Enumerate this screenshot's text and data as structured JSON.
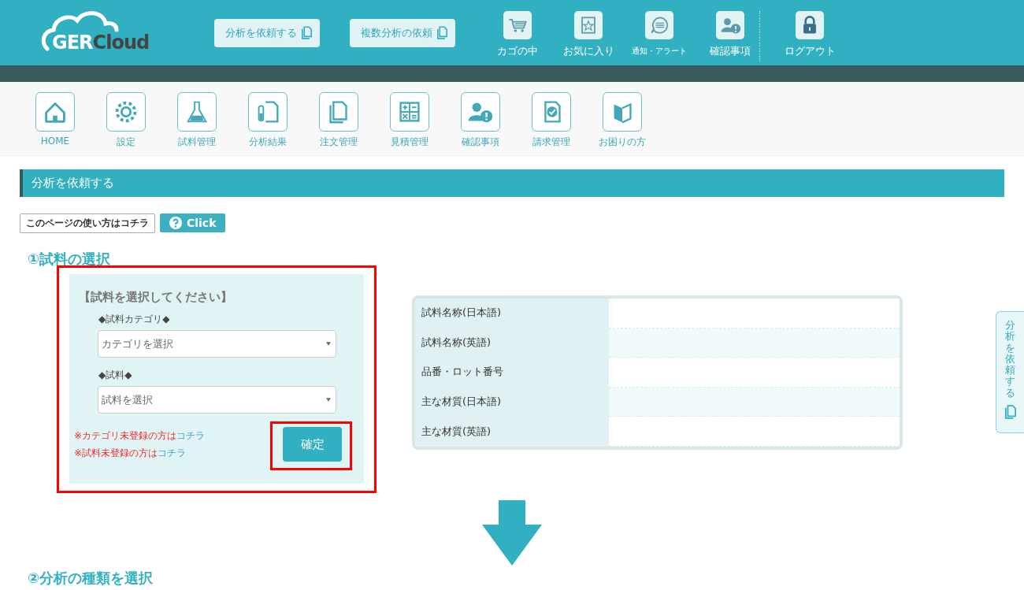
{
  "header": {
    "logo": {
      "text_1": "GER",
      "text_2": "Cloud"
    },
    "buttons": [
      "分析を依頼する",
      "複数分析の依頼"
    ],
    "icon_items": [
      {
        "label": "カゴの中",
        "kind": "normal"
      },
      {
        "label": "お気に入り",
        "kind": "normal"
      },
      {
        "label": "通知・アラート",
        "kind": "small"
      },
      {
        "label": "確認事項",
        "kind": "normal"
      }
    ],
    "logout": "ログアウト"
  },
  "nav": [
    "HOME",
    "設定",
    "試料管理",
    "分析結果",
    "注文管理",
    "見積管理",
    "確認事項",
    "請求管理",
    "お困りの方"
  ],
  "page_title": "分析を依頼する",
  "help": {
    "label": "このページの使い方はコチラ",
    "button": "Click"
  },
  "step_1": {
    "heading": "①試料の選択",
    "panel": {
      "highlighted": true,
      "title": "【試料を選択してください】",
      "fields": [
        {
          "label": "◆試料カテゴリ◆",
          "placeholder": "カテゴリを選択"
        },
        {
          "label": "◆試料◆",
          "placeholder": "試料を選択"
        }
      ],
      "notes": [
        {
          "text": "※カテゴリ未登録の方は",
          "link": "コチラ"
        },
        {
          "text": "※試料未登録の方は",
          "link": "コチラ"
        }
      ],
      "confirm": {
        "label": "確定",
        "highlighted": true
      }
    },
    "table": {
      "rows": [
        "試料名称(日本語)",
        "試料名称(英語)",
        "品番・ロット番号",
        "主な材質(日本語)",
        "主な材質(英語)"
      ]
    }
  },
  "step_2": {
    "heading": "②分析の種類を選択"
  },
  "side_tab": "分析を依頼する"
}
